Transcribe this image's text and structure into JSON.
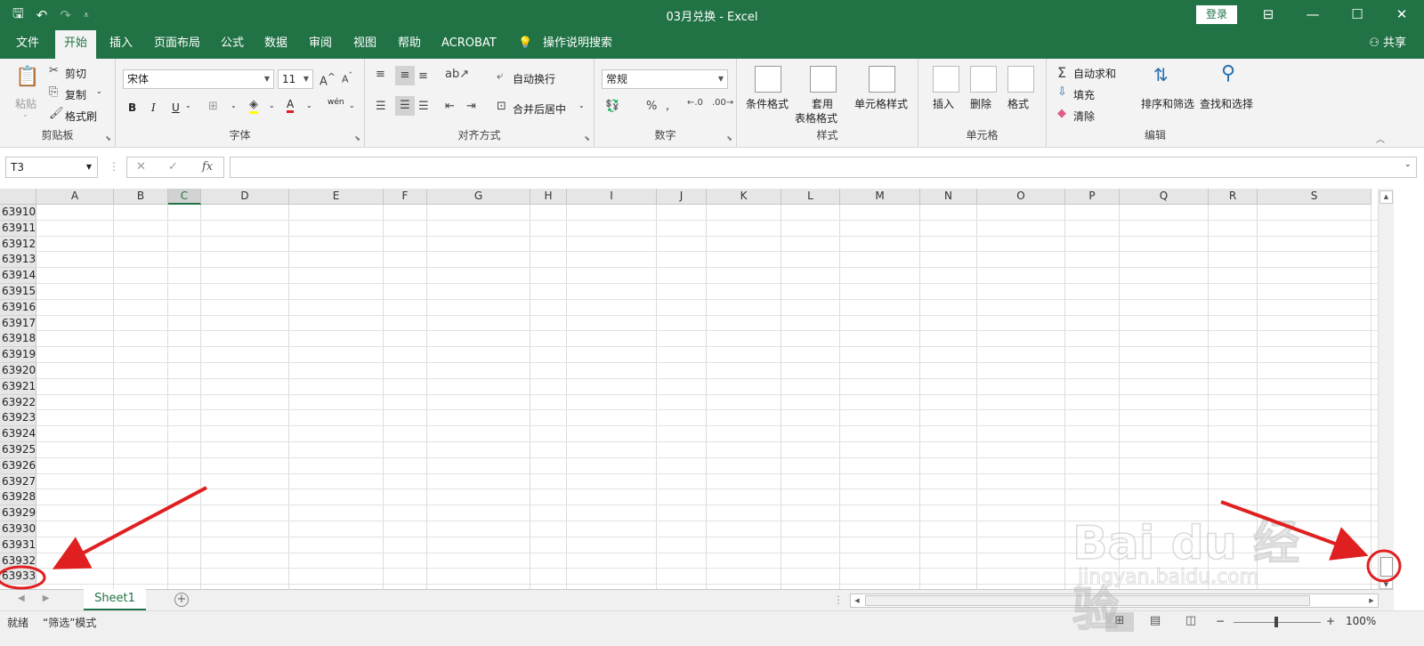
{
  "window": {
    "title": "03月兑换  -  Excel",
    "login": "登录",
    "quick_access": [
      "save-icon",
      "undo-icon",
      "redo-icon",
      "customize-icon"
    ]
  },
  "tabs": [
    "文件",
    "开始",
    "插入",
    "页面布局",
    "公式",
    "数据",
    "审阅",
    "视图",
    "帮助",
    "ACROBAT",
    "操作说明搜索"
  ],
  "active_tab": "开始",
  "share": "共享",
  "ribbon": {
    "clipboard": {
      "label": "剪贴板",
      "paste": "粘贴",
      "cut": "剪切",
      "copy": "复制",
      "format_painter": "格式刷"
    },
    "font": {
      "label": "字体",
      "font_name": "宋体",
      "font_size": "11",
      "bold": "B",
      "italic": "I",
      "underline": "U",
      "font_color_glyph": "A",
      "phonetic_glyph": "wén"
    },
    "alignment": {
      "label": "对齐方式",
      "wrap_text": "自动换行",
      "merge_center": "合并后居中"
    },
    "number": {
      "label": "数字",
      "format": "常规"
    },
    "styles": {
      "label": "样式",
      "conditional": "条件格式",
      "table_format_line1": "套用",
      "table_format_line2": "表格格式",
      "cell_styles": "单元格样式"
    },
    "cells": {
      "label": "单元格",
      "insert": "插入",
      "delete": "删除",
      "format": "格式"
    },
    "editing": {
      "label": "编辑",
      "autosum": "自动求和",
      "fill": "填充",
      "clear": "清除",
      "sort_filter": "排序和筛选",
      "find_select": "查找和选择"
    }
  },
  "formula_bar": {
    "name_box": "T3",
    "formula": "",
    "fx_label": "fx"
  },
  "grid": {
    "columns": [
      "A",
      "B",
      "C",
      "D",
      "E",
      "F",
      "G",
      "H",
      "I",
      "J",
      "K",
      "L",
      "M",
      "N",
      "O",
      "P",
      "Q",
      "R",
      "S"
    ],
    "selected_column": "C",
    "rows": [
      "63910",
      "63911",
      "63912",
      "63913",
      "63914",
      "63915",
      "63916",
      "63917",
      "63918",
      "63919",
      "63920",
      "63921",
      "63922",
      "63923",
      "63924",
      "63925",
      "63926",
      "63927",
      "63928",
      "63929",
      "63930",
      "63931",
      "63932",
      "63933"
    ]
  },
  "sheets": [
    "Sheet1"
  ],
  "status": {
    "ready": "就绪",
    "mode": "“筛选”模式",
    "zoom": "100%",
    "zoom_minus": "−",
    "zoom_plus": "+"
  },
  "watermark": {
    "brand": "Bai du 经验",
    "url": "jingyan.baidu.com"
  },
  "annotations": {
    "arrow_color": "#e02020",
    "targets": [
      "last-row-header-63933",
      "vertical-scroll-thumb"
    ]
  },
  "colors": {
    "accent": "#217346",
    "ribbon_bg": "#f3f3f3",
    "annotation": "#e02020"
  }
}
